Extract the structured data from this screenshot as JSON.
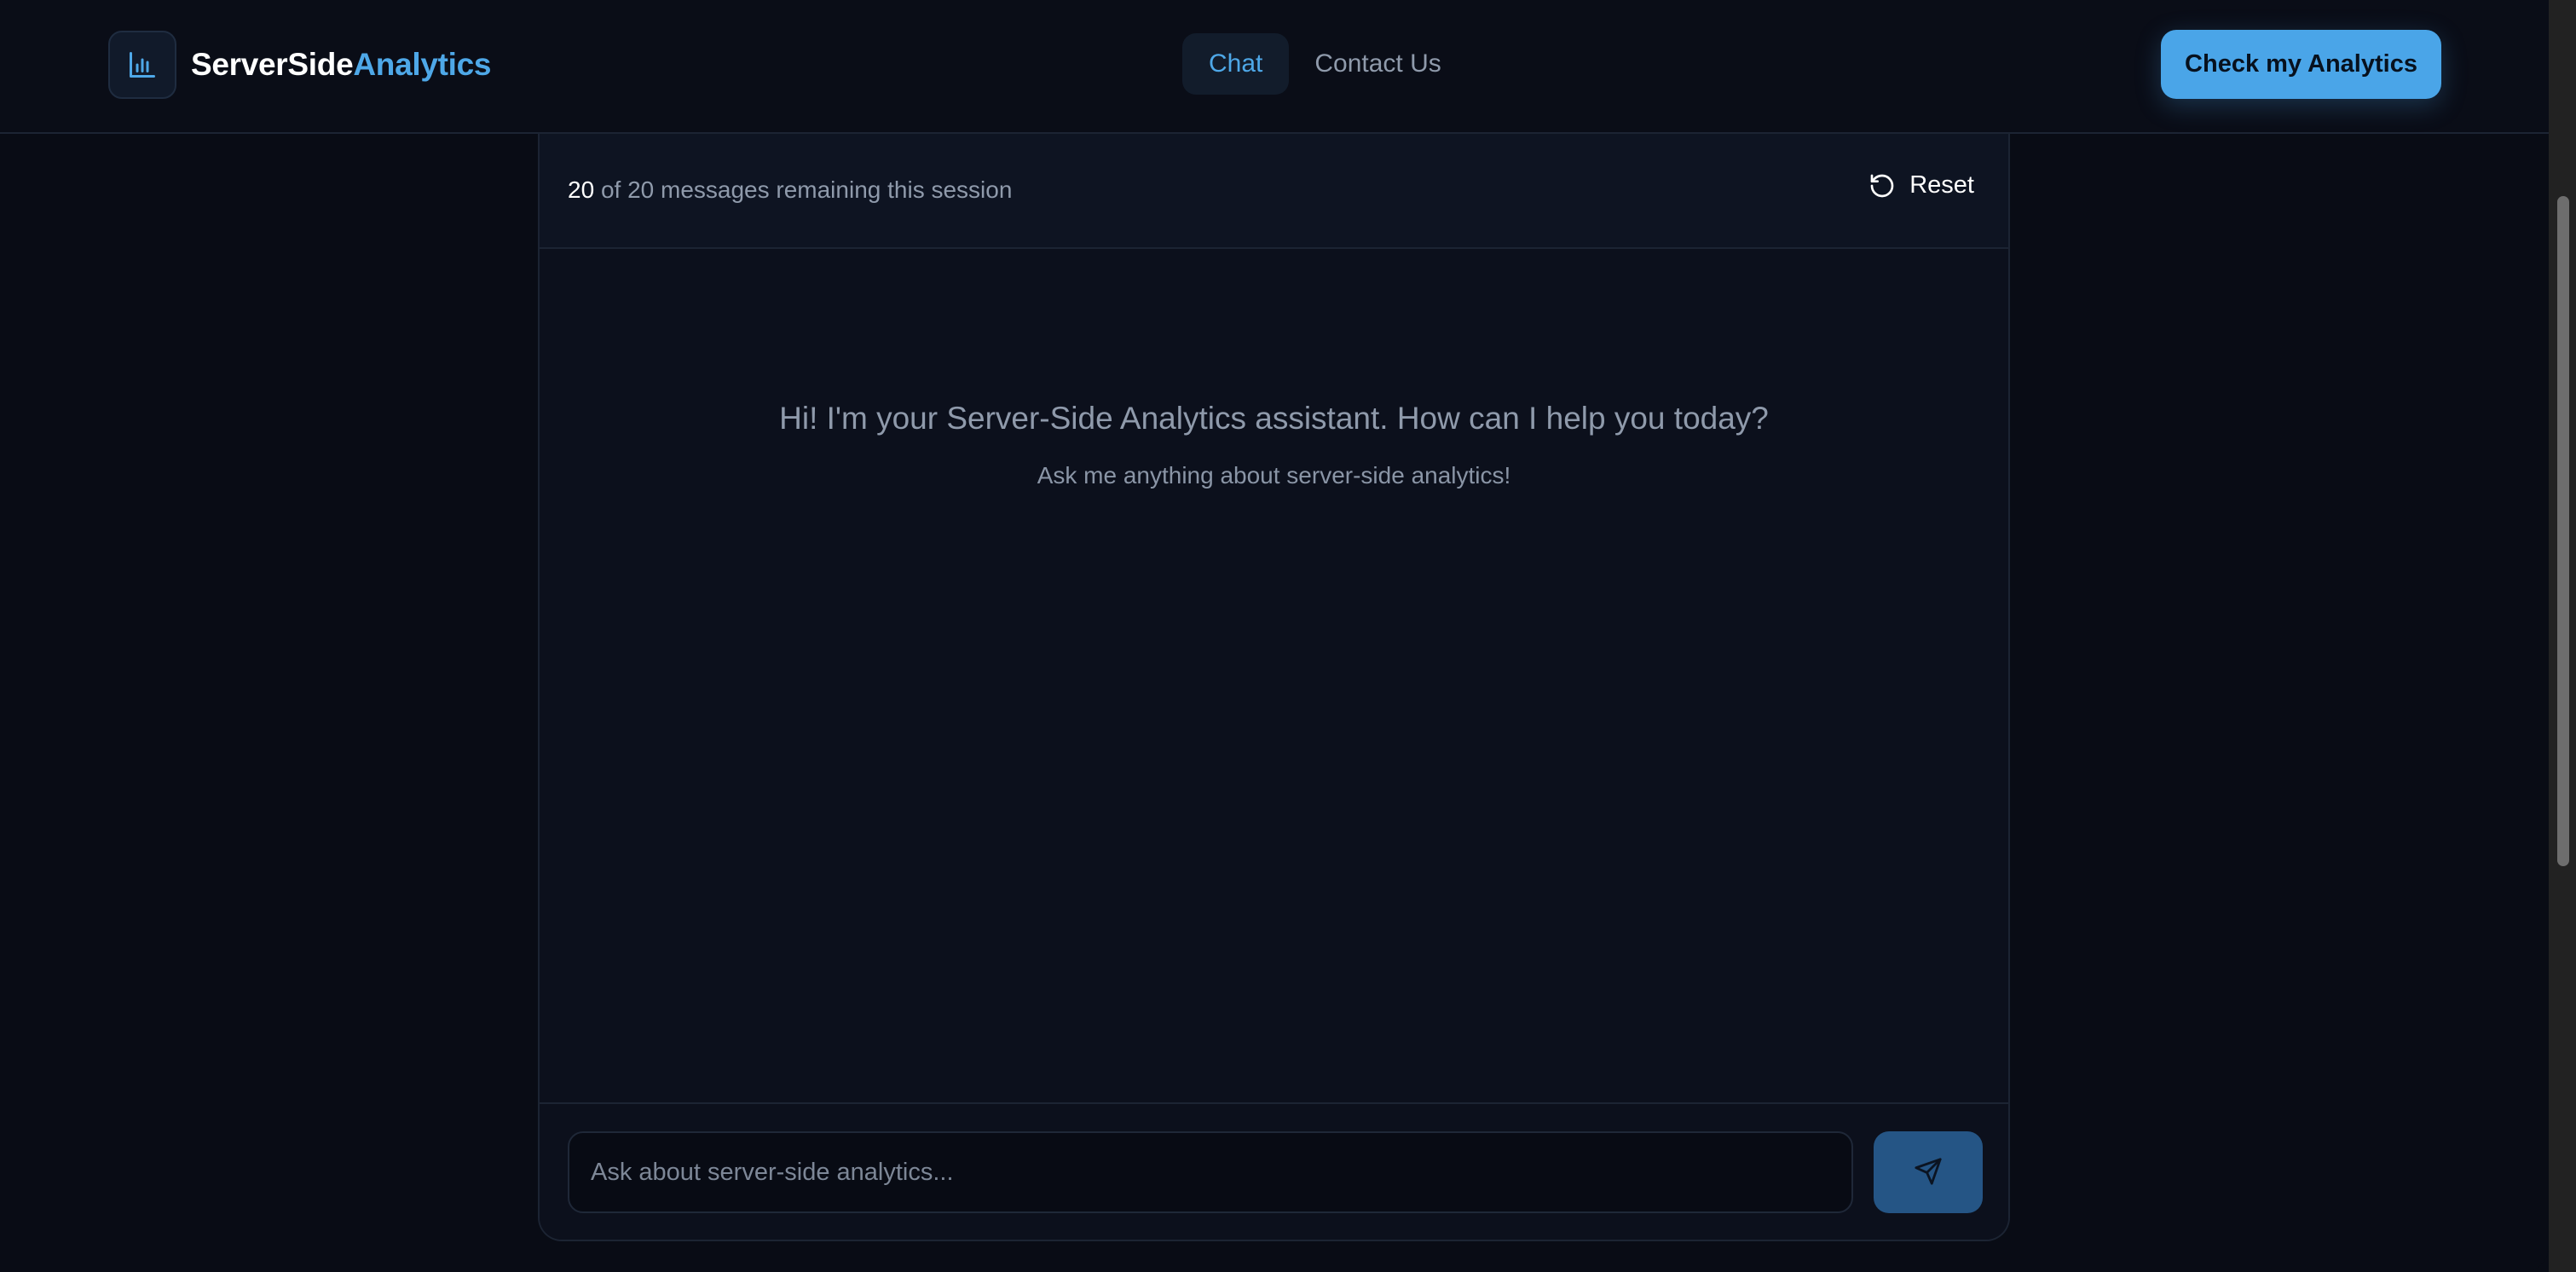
{
  "brand": {
    "name_part1": "ServerSide",
    "name_part2": "Analytics",
    "logo_icon": "bar-chart-icon",
    "accent_color": "#4ea8e8"
  },
  "nav": {
    "items": [
      {
        "label": "Chat",
        "active": true
      },
      {
        "label": "Contact Us",
        "active": false
      }
    ]
  },
  "cta": {
    "label": "Check my Analytics"
  },
  "session": {
    "remaining": "20",
    "suffix": "of 20 messages remaining this session",
    "reset_label": "Reset",
    "reset_icon": "rotate-ccw-icon"
  },
  "welcome": {
    "title": "Hi! I'm your Server-Side Analytics assistant. How can I help you today?",
    "subtitle": "Ask me anything about server-side analytics!"
  },
  "composer": {
    "placeholder": "Ask about server-side analytics...",
    "value": "",
    "send_icon": "send-icon"
  }
}
